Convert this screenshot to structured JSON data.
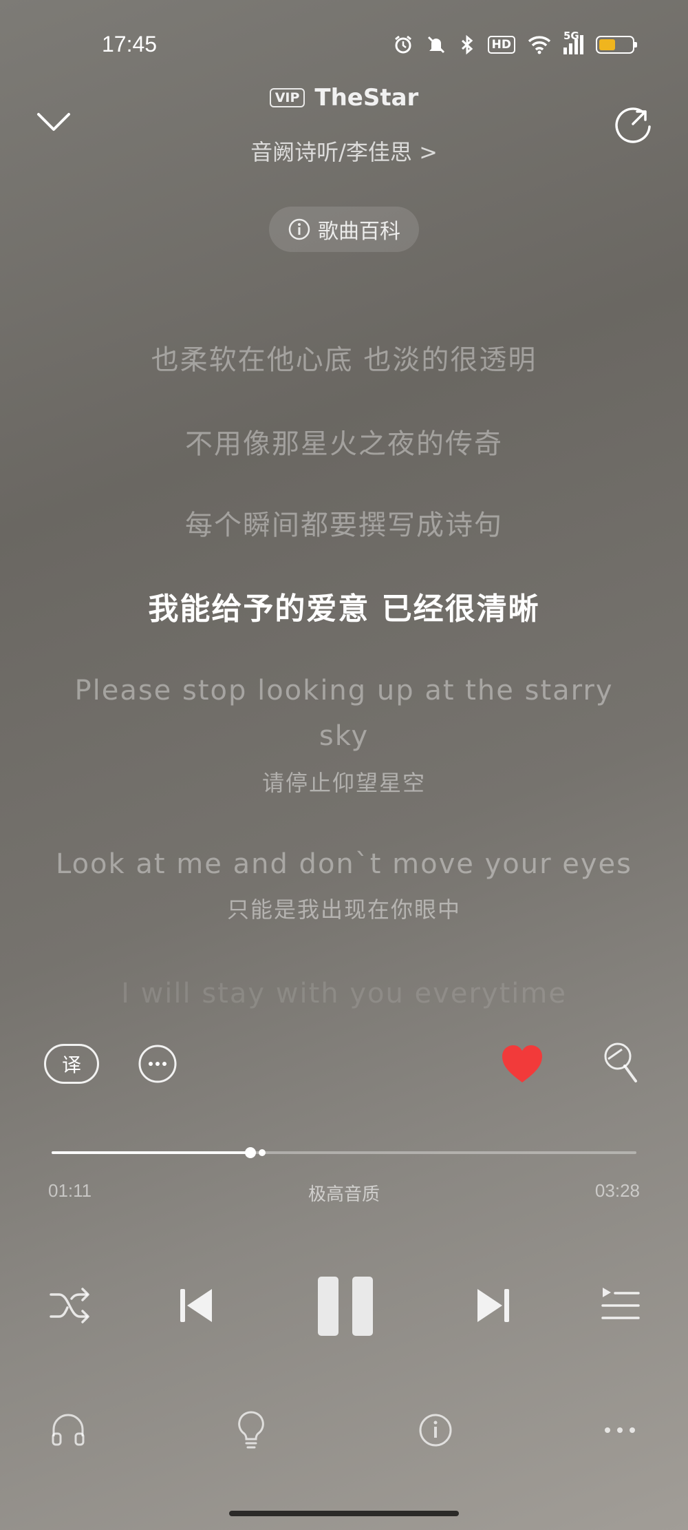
{
  "status_bar": {
    "time": "17:45",
    "hd": "HD",
    "network": "5G",
    "battery_level": 0.5
  },
  "header": {
    "vip": "VIP",
    "song_title": "TheStar",
    "artist": "音阙诗听/李佳思 >",
    "wiki_label": "歌曲百科"
  },
  "lyrics": [
    {
      "text": "也柔软在他心底 也淡的很透明",
      "state": "past"
    },
    {
      "text": "不用像那星火之夜的传奇",
      "state": "past"
    },
    {
      "text": "每个瞬间都要撰写成诗句",
      "state": "past"
    },
    {
      "text": "我能给予的爱意 已经很清晰",
      "state": "active"
    },
    {
      "text": "Please stop looking up at the starry",
      "state": "future"
    },
    {
      "text": "sky",
      "state": "future"
    },
    {
      "text": "请停止仰望星空",
      "state": "translation"
    },
    {
      "text": "Look at me and don`t move your eyes",
      "state": "future"
    },
    {
      "text": "只能是我出现在你眼中",
      "state": "translation"
    },
    {
      "text": "I will stay with you everytime",
      "state": "faded"
    }
  ],
  "actions": {
    "translate_label": "译",
    "liked": true,
    "like_color": "#f23a3a"
  },
  "player": {
    "elapsed": "01:11",
    "total": "03:28",
    "progress": 0.34,
    "buffered": 0.36,
    "quality": "极高音质",
    "is_playing": true
  },
  "icons": {
    "collapse": "chevron-down-icon",
    "share": "share-rotate-icon",
    "info": "info-icon",
    "more": "more-dots-icon",
    "heart": "heart-icon",
    "mic": "microphone-icon",
    "shuffle": "shuffle-icon",
    "prev": "skip-previous-icon",
    "pause": "pause-icon",
    "next": "skip-next-icon",
    "playlist": "playlist-icon",
    "headphones": "headphones-icon",
    "bulb": "lightbulb-icon",
    "song_info": "info-circle-icon",
    "menu": "more-horizontal-icon"
  }
}
